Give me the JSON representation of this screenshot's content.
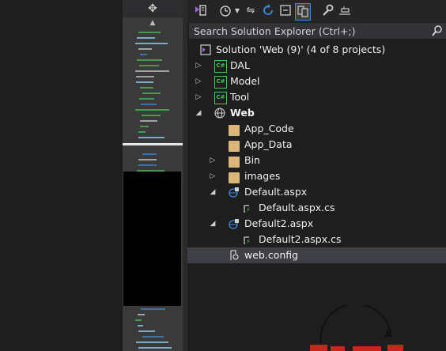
{
  "colors": {
    "accent": "#3b8bdc",
    "folder": "#dcb67a",
    "cs_green": "#4ec15a",
    "watermark_red": "#c6261e"
  },
  "minimap": {
    "split_icon": "split-window-icon",
    "scroll_icon": "scroll-up-icon"
  },
  "toolbar": {
    "icons": [
      "vs-switch-views-icon",
      "pending-changes-icon",
      "dropdown-icon",
      "sync-icon",
      "refresh-icon",
      "collapse-all-icon",
      "show-all-files-icon",
      "properties-icon",
      "preview-icon"
    ]
  },
  "search": {
    "placeholder": "Search Solution Explorer (Ctrl+;)"
  },
  "tree": {
    "solution": "Solution 'Web (9)' (4 of 8 projects)",
    "dal": "DAL",
    "model": "Model",
    "tool": "Tool",
    "web": "Web",
    "app_code": "App_Code",
    "app_data": "App_Data",
    "bin": "Bin",
    "images": "images",
    "default_aspx": "Default.aspx",
    "default_aspx_cs": "Default.aspx.cs",
    "default2_aspx": "Default2.aspx",
    "default2_aspx_cs": "Default2.aspx.cs",
    "web_config": "web.config"
  },
  "cs_badge": "C#"
}
